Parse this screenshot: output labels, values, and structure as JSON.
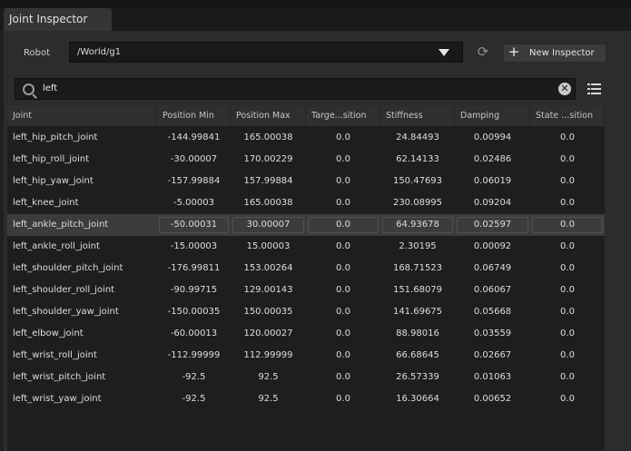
{
  "window": {
    "tab_title": "Joint Inspector"
  },
  "robot": {
    "label": "Robot",
    "value": "/World/g1"
  },
  "toolbar": {
    "new_inspector_label": "New Inspector",
    "plus_glyph": "+",
    "refresh_glyph": "⟳"
  },
  "search": {
    "value": "left",
    "clear_glyph": "✕"
  },
  "icons": {
    "search": "search-icon",
    "clear": "clear-icon",
    "refresh": "refresh-icon",
    "list": "list-view-icon",
    "dropdown": "chevron-down-icon"
  },
  "table": {
    "headers": [
      "Joint",
      "Position Min",
      "Position Max",
      "Targe...sition",
      "Stiffness",
      "Damping",
      "State ...sition"
    ],
    "rows": [
      [
        "left_hip_pitch_joint",
        "-144.99841",
        "165.00038",
        "0.0",
        "24.84493",
        "0.00994",
        "0.0"
      ],
      [
        "left_hip_roll_joint",
        "-30.00007",
        "170.00229",
        "0.0",
        "62.14133",
        "0.02486",
        "0.0"
      ],
      [
        "left_hip_yaw_joint",
        "-157.99884",
        "157.99884",
        "0.0",
        "150.47693",
        "0.06019",
        "0.0"
      ],
      [
        "left_knee_joint",
        "-5.00003",
        "165.00038",
        "0.0",
        "230.08995",
        "0.09204",
        "0.0"
      ],
      [
        "left_ankle_pitch_joint",
        "-50.00031",
        "30.00007",
        "0.0",
        "64.93678",
        "0.02597",
        "0.0"
      ],
      [
        "left_ankle_roll_joint",
        "-15.00003",
        "15.00003",
        "0.0",
        "2.30195",
        "0.00092",
        "0.0"
      ],
      [
        "left_shoulder_pitch_joint",
        "-176.99811",
        "153.00264",
        "0.0",
        "168.71523",
        "0.06749",
        "0.0"
      ],
      [
        "left_shoulder_roll_joint",
        "-90.99715",
        "129.00143",
        "0.0",
        "151.68079",
        "0.06067",
        "0.0"
      ],
      [
        "left_shoulder_yaw_joint",
        "-150.00035",
        "150.00035",
        "0.0",
        "141.69675",
        "0.05668",
        "0.0"
      ],
      [
        "left_elbow_joint",
        "-60.00013",
        "120.00027",
        "0.0",
        "88.98016",
        "0.03559",
        "0.0"
      ],
      [
        "left_wrist_roll_joint",
        "-112.99999",
        "112.99999",
        "0.0",
        "66.68645",
        "0.02667",
        "0.0"
      ],
      [
        "left_wrist_pitch_joint",
        "-92.5",
        "92.5",
        "0.0",
        "26.57339",
        "0.01063",
        "0.0"
      ],
      [
        "left_wrist_yaw_joint",
        "-92.5",
        "92.5",
        "0.0",
        "16.30664",
        "0.00652",
        "0.0"
      ]
    ],
    "selected_row": 4
  }
}
